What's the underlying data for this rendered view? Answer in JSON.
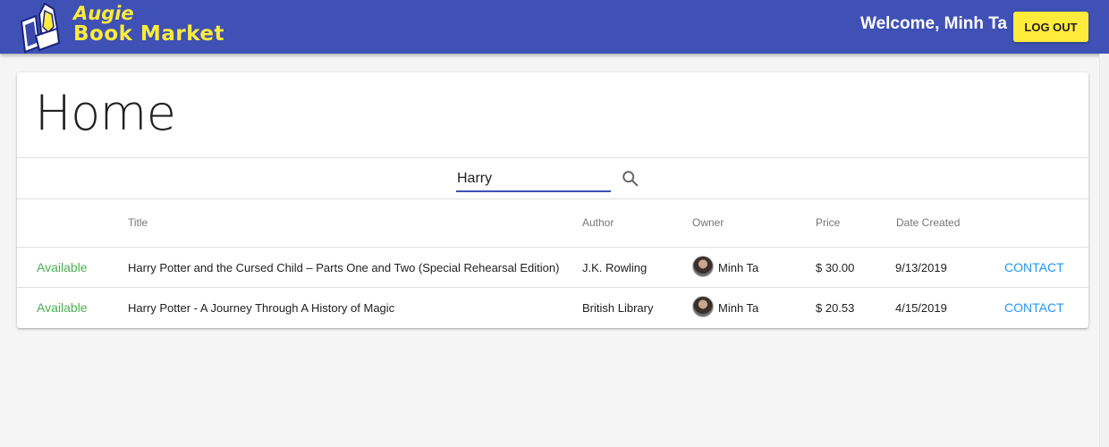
{
  "header": {
    "brand_line1": "Augie",
    "brand_line2": "Book Market",
    "welcome": "Welcome, Minh Ta",
    "logout_label": "LOG OUT",
    "colors": {
      "appbar": "#3f51b5",
      "accent": "#ffeb3b"
    }
  },
  "page": {
    "title": "Home"
  },
  "search": {
    "value": "Harry",
    "icon": "search-icon"
  },
  "table": {
    "columns": [
      "",
      "Title",
      "Author",
      "Owner",
      "Price",
      "Date Created",
      ""
    ],
    "rows": [
      {
        "status": "Available",
        "title": "Harry Potter and the Cursed Child – Parts One and Two (Special Rehearsal Edition)",
        "author": "J.K. Rowling",
        "owner": "Minh Ta",
        "price": "$ 30.00",
        "date": "9/13/2019",
        "action": "CONTACT"
      },
      {
        "status": "Available",
        "title": "Harry Potter - A Journey Through A History of Magic",
        "author": "British Library",
        "owner": "Minh Ta",
        "price": "$ 20.53",
        "date": "4/15/2019",
        "action": "CONTACT"
      }
    ],
    "colors": {
      "available": "#4caf50",
      "link": "#2196f3"
    }
  }
}
